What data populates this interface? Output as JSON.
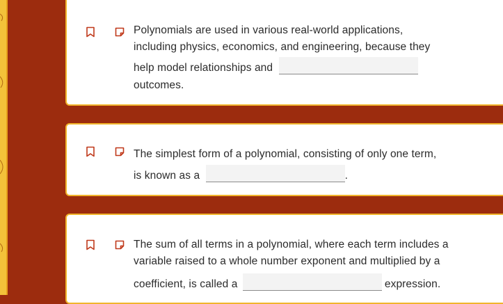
{
  "questions": [
    {
      "lines": [
        "Polynomials are used in various real-world applications,",
        "including physics, economics, and engineering, because they"
      ],
      "before_blank": "help model relationships and",
      "after_blank": "",
      "tail": "outcomes."
    },
    {
      "lines": [
        "The simplest form of a polynomial, consisting of only one term,"
      ],
      "before_blank": "is known as a",
      "after_blank": ".",
      "tail": ""
    },
    {
      "lines": [
        "The sum of all terms in a polynomial, where each term includes a",
        "variable raised to a whole number exponent and multiplied by a"
      ],
      "before_blank": "coefficient, is called a",
      "after_blank": "expression.",
      "tail": ""
    }
  ],
  "colors": {
    "background": "#9c2c0e",
    "card_border": "#f1b52c",
    "icon": "#c0391b",
    "strip": "#f3c23a"
  },
  "icons": [
    "bookmark-icon",
    "note-icon"
  ]
}
